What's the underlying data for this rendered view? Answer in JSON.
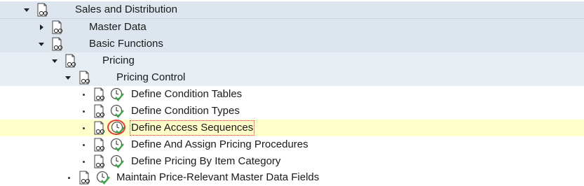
{
  "tree": {
    "nodes": [
      {
        "label": "Sales and Distribution",
        "expander": "expanded",
        "has_exec_icon": false
      },
      {
        "label": "Master Data",
        "expander": "collapsed",
        "has_exec_icon": false
      },
      {
        "label": "Basic Functions",
        "expander": "expanded",
        "has_exec_icon": false
      },
      {
        "label": "Pricing",
        "expander": "expanded",
        "has_exec_icon": false
      },
      {
        "label": "Pricing Control",
        "expander": "expanded",
        "has_exec_icon": false
      },
      {
        "label": "Define Condition Tables",
        "expander": "leaf",
        "has_exec_icon": true
      },
      {
        "label": "Define Condition Types",
        "expander": "leaf",
        "has_exec_icon": true
      },
      {
        "label": "Define Access Sequences",
        "expander": "leaf",
        "has_exec_icon": true,
        "selected": true,
        "highlighted_icon": true
      },
      {
        "label": "Define And Assign Pricing Procedures",
        "expander": "leaf",
        "has_exec_icon": true
      },
      {
        "label": "Define Pricing By Item Category",
        "expander": "leaf",
        "has_exec_icon": true
      },
      {
        "label": "Maintain Price-Relevant Master Data Fields",
        "expander": "leaf",
        "has_exec_icon": true
      }
    ]
  },
  "colors": {
    "row_shade": "#dde6ee",
    "selected_row": "#ffffcc",
    "highlight_ring": "#e03c3c",
    "exec_icon_check": "#3aa547"
  },
  "icons": {
    "document": "document-glasses-icon",
    "execute": "clock-check-icon"
  }
}
